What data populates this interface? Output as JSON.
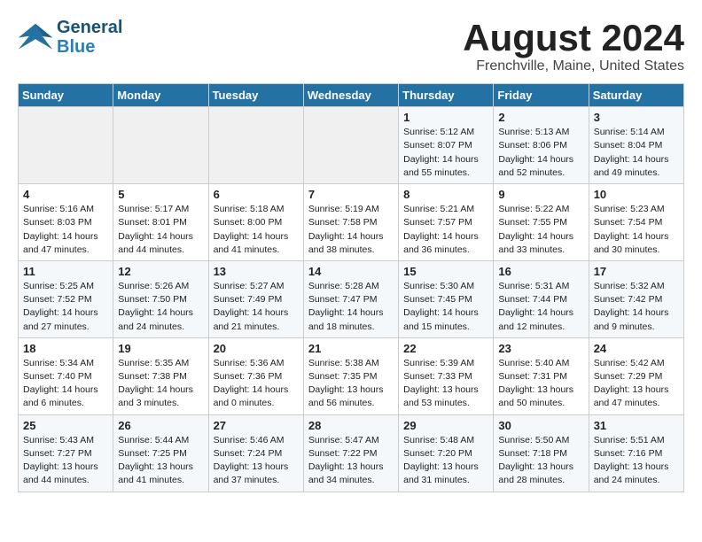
{
  "header": {
    "logo_line1": "General",
    "logo_line2": "Blue",
    "title": "August 2024",
    "subtitle": "Frenchville, Maine, United States"
  },
  "weekdays": [
    "Sunday",
    "Monday",
    "Tuesday",
    "Wednesday",
    "Thursday",
    "Friday",
    "Saturday"
  ],
  "weeks": [
    [
      {
        "day": "",
        "info": ""
      },
      {
        "day": "",
        "info": ""
      },
      {
        "day": "",
        "info": ""
      },
      {
        "day": "",
        "info": ""
      },
      {
        "day": "1",
        "info": "Sunrise: 5:12 AM\nSunset: 8:07 PM\nDaylight: 14 hours\nand 55 minutes."
      },
      {
        "day": "2",
        "info": "Sunrise: 5:13 AM\nSunset: 8:06 PM\nDaylight: 14 hours\nand 52 minutes."
      },
      {
        "day": "3",
        "info": "Sunrise: 5:14 AM\nSunset: 8:04 PM\nDaylight: 14 hours\nand 49 minutes."
      }
    ],
    [
      {
        "day": "4",
        "info": "Sunrise: 5:16 AM\nSunset: 8:03 PM\nDaylight: 14 hours\nand 47 minutes."
      },
      {
        "day": "5",
        "info": "Sunrise: 5:17 AM\nSunset: 8:01 PM\nDaylight: 14 hours\nand 44 minutes."
      },
      {
        "day": "6",
        "info": "Sunrise: 5:18 AM\nSunset: 8:00 PM\nDaylight: 14 hours\nand 41 minutes."
      },
      {
        "day": "7",
        "info": "Sunrise: 5:19 AM\nSunset: 7:58 PM\nDaylight: 14 hours\nand 38 minutes."
      },
      {
        "day": "8",
        "info": "Sunrise: 5:21 AM\nSunset: 7:57 PM\nDaylight: 14 hours\nand 36 minutes."
      },
      {
        "day": "9",
        "info": "Sunrise: 5:22 AM\nSunset: 7:55 PM\nDaylight: 14 hours\nand 33 minutes."
      },
      {
        "day": "10",
        "info": "Sunrise: 5:23 AM\nSunset: 7:54 PM\nDaylight: 14 hours\nand 30 minutes."
      }
    ],
    [
      {
        "day": "11",
        "info": "Sunrise: 5:25 AM\nSunset: 7:52 PM\nDaylight: 14 hours\nand 27 minutes."
      },
      {
        "day": "12",
        "info": "Sunrise: 5:26 AM\nSunset: 7:50 PM\nDaylight: 14 hours\nand 24 minutes."
      },
      {
        "day": "13",
        "info": "Sunrise: 5:27 AM\nSunset: 7:49 PM\nDaylight: 14 hours\nand 21 minutes."
      },
      {
        "day": "14",
        "info": "Sunrise: 5:28 AM\nSunset: 7:47 PM\nDaylight: 14 hours\nand 18 minutes."
      },
      {
        "day": "15",
        "info": "Sunrise: 5:30 AM\nSunset: 7:45 PM\nDaylight: 14 hours\nand 15 minutes."
      },
      {
        "day": "16",
        "info": "Sunrise: 5:31 AM\nSunset: 7:44 PM\nDaylight: 14 hours\nand 12 minutes."
      },
      {
        "day": "17",
        "info": "Sunrise: 5:32 AM\nSunset: 7:42 PM\nDaylight: 14 hours\nand 9 minutes."
      }
    ],
    [
      {
        "day": "18",
        "info": "Sunrise: 5:34 AM\nSunset: 7:40 PM\nDaylight: 14 hours\nand 6 minutes."
      },
      {
        "day": "19",
        "info": "Sunrise: 5:35 AM\nSunset: 7:38 PM\nDaylight: 14 hours\nand 3 minutes."
      },
      {
        "day": "20",
        "info": "Sunrise: 5:36 AM\nSunset: 7:36 PM\nDaylight: 14 hours\nand 0 minutes."
      },
      {
        "day": "21",
        "info": "Sunrise: 5:38 AM\nSunset: 7:35 PM\nDaylight: 13 hours\nand 56 minutes."
      },
      {
        "day": "22",
        "info": "Sunrise: 5:39 AM\nSunset: 7:33 PM\nDaylight: 13 hours\nand 53 minutes."
      },
      {
        "day": "23",
        "info": "Sunrise: 5:40 AM\nSunset: 7:31 PM\nDaylight: 13 hours\nand 50 minutes."
      },
      {
        "day": "24",
        "info": "Sunrise: 5:42 AM\nSunset: 7:29 PM\nDaylight: 13 hours\nand 47 minutes."
      }
    ],
    [
      {
        "day": "25",
        "info": "Sunrise: 5:43 AM\nSunset: 7:27 PM\nDaylight: 13 hours\nand 44 minutes."
      },
      {
        "day": "26",
        "info": "Sunrise: 5:44 AM\nSunset: 7:25 PM\nDaylight: 13 hours\nand 41 minutes."
      },
      {
        "day": "27",
        "info": "Sunrise: 5:46 AM\nSunset: 7:24 PM\nDaylight: 13 hours\nand 37 minutes."
      },
      {
        "day": "28",
        "info": "Sunrise: 5:47 AM\nSunset: 7:22 PM\nDaylight: 13 hours\nand 34 minutes."
      },
      {
        "day": "29",
        "info": "Sunrise: 5:48 AM\nSunset: 7:20 PM\nDaylight: 13 hours\nand 31 minutes."
      },
      {
        "day": "30",
        "info": "Sunrise: 5:50 AM\nSunset: 7:18 PM\nDaylight: 13 hours\nand 28 minutes."
      },
      {
        "day": "31",
        "info": "Sunrise: 5:51 AM\nSunset: 7:16 PM\nDaylight: 13 hours\nand 24 minutes."
      }
    ]
  ]
}
